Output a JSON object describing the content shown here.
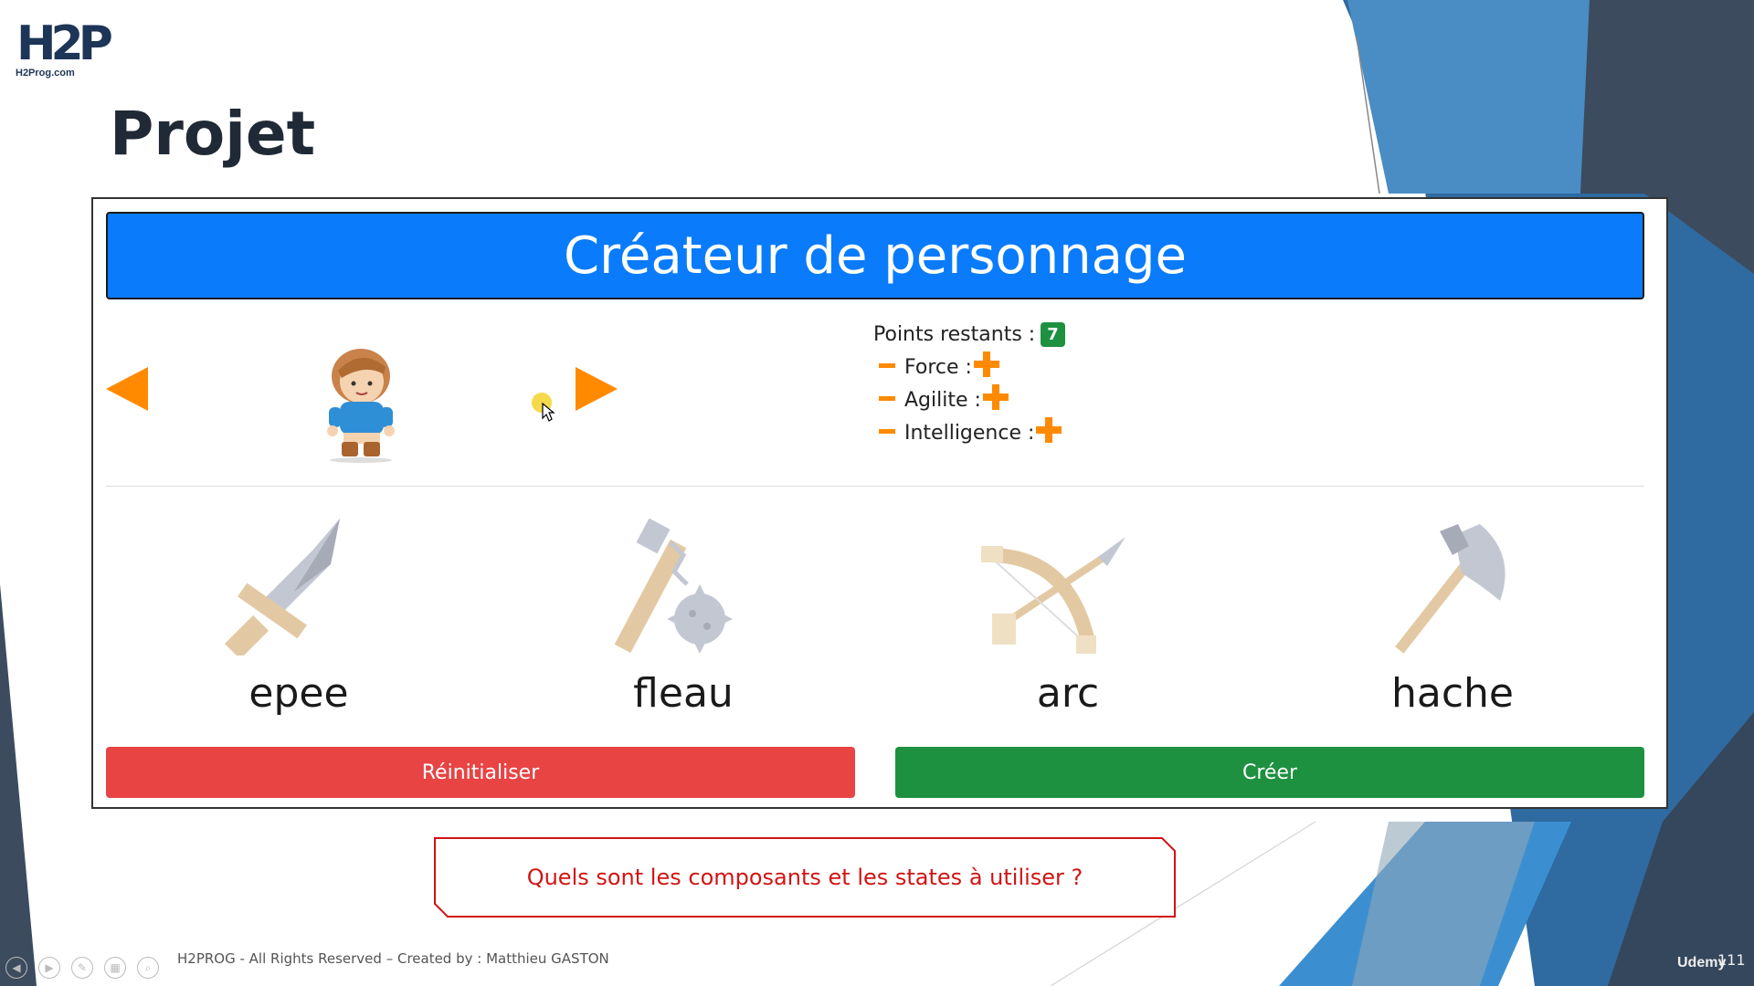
{
  "slide": {
    "logo_mark": "H2P",
    "logo_site": "H2Prog.com",
    "title": "Projet",
    "question": "Quels sont les composants et les states à utiliser ?",
    "footer": "H2PROG - All Rights Reserved – Created by : Matthieu GASTON",
    "page_number": "111",
    "watermark": "Udemy"
  },
  "app": {
    "header_title": "Créateur de personnage",
    "points_label": "Points restants :",
    "points_value": "7",
    "stats": [
      {
        "label": "Force :"
      },
      {
        "label": "Agilite :"
      },
      {
        "label": "Intelligence :"
      }
    ],
    "weapons": [
      {
        "label": "epee",
        "icon": "sword-icon"
      },
      {
        "label": "fleau",
        "icon": "flail-icon"
      },
      {
        "label": "arc",
        "icon": "crossbow-icon"
      },
      {
        "label": "hache",
        "icon": "axe-icon"
      }
    ],
    "reset_label": "Réinitialiser",
    "create_label": "Créer"
  },
  "colors": {
    "header": "#0a7bfa",
    "accent_orange": "#ff8a00",
    "reset_red": "#e84444",
    "create_green": "#1e9140",
    "question_red": "#d11414"
  }
}
